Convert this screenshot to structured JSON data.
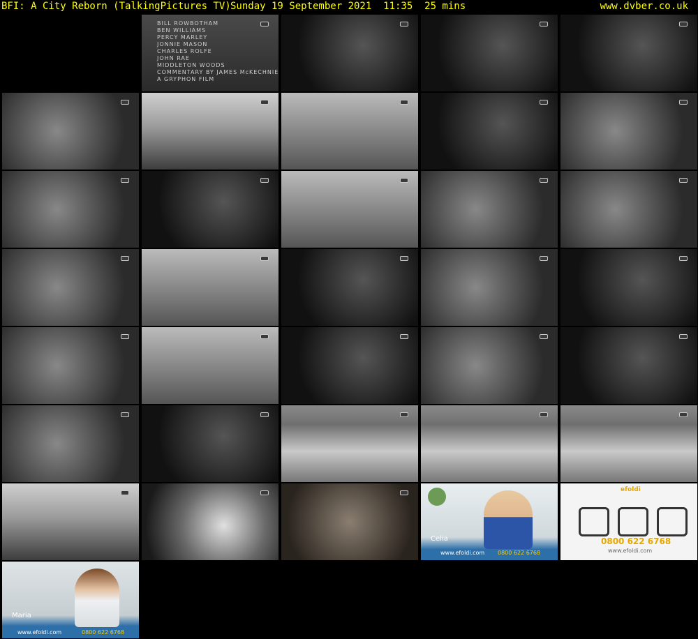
{
  "header": {
    "title": "BFI: A City Reborn (TalkingPictures TV)",
    "datetime": "Sunday 19 September 2021  11:35  25 mins",
    "site": "www.dvber.co.uk"
  },
  "colors": {
    "header_text": "#ffff00",
    "background": "#000000"
  },
  "thumbnails": [
    {
      "style": "blank"
    },
    {
      "style": "title",
      "credits": "BILL ROWBOTHAM\nBEN WILLIAMS\nPERCY MARLEY\nJONNIE MASON\nCHARLES ROLFE\nJOHN RAE\nMIDDLETON WOODS\nCOMMENTARY BY JAMES McKECHNIE\nA GRYPHON FILM"
    },
    {
      "style": "dark"
    },
    {
      "style": "dark"
    },
    {
      "style": "dark"
    },
    {
      "style": "mid"
    },
    {
      "style": "sky"
    },
    {
      "style": "light"
    },
    {
      "style": "dark"
    },
    {
      "style": "mid"
    },
    {
      "style": "mid"
    },
    {
      "style": "dark"
    },
    {
      "style": "light"
    },
    {
      "style": "mid"
    },
    {
      "style": "mid"
    },
    {
      "style": "mid"
    },
    {
      "style": "light"
    },
    {
      "style": "dark"
    },
    {
      "style": "mid"
    },
    {
      "style": "dark"
    },
    {
      "style": "mid"
    },
    {
      "style": "light"
    },
    {
      "style": "dark"
    },
    {
      "style": "mid"
    },
    {
      "style": "dark"
    },
    {
      "style": "mid"
    },
    {
      "style": "dark"
    },
    {
      "style": "aerial"
    },
    {
      "style": "aerial"
    },
    {
      "style": "aerial"
    },
    {
      "style": "sky"
    },
    {
      "style": "smoke"
    },
    {
      "style": "sepia"
    },
    {
      "style": "ad-studio",
      "name": "Celia",
      "url": "www.efoldi.com",
      "phone": "0800 622 6768"
    },
    {
      "style": "ad-product",
      "brand": "efoldi",
      "phone": "0800 622 6768",
      "url": "www.efoldi.com"
    },
    {
      "style": "ad-studio2",
      "name": "Maria",
      "url": "www.efoldi.com",
      "phone": "0800 622 6768"
    }
  ]
}
